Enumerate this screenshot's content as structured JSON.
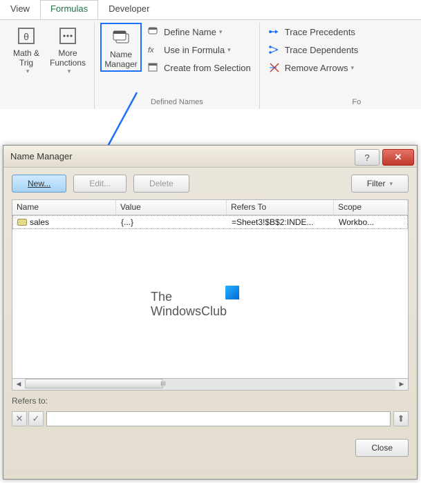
{
  "ribbon": {
    "tabs": {
      "view": "View",
      "formulas": "Formulas",
      "developer": "Developer"
    },
    "mathTrig": "Math & Trig",
    "moreFunc": "More Functions",
    "nameMgr": "Name Manager",
    "defineName": "Define Name",
    "useInFormula": "Use in Formula",
    "createFromSel": "Create from Selection",
    "definedNamesGroup": "Defined Names",
    "tracePrec": "Trace Precedents",
    "traceDep": "Trace Dependents",
    "removeArrows": "Remove Arrows",
    "formulaAuditGroup": "Fo"
  },
  "dialog": {
    "title": "Name Manager",
    "newBtn": "New...",
    "editBtn": "Edit...",
    "deleteBtn": "Delete",
    "filterBtn": "Filter",
    "cols": {
      "name": "Name",
      "value": "Value",
      "refers": "Refers To",
      "scope": "Scope"
    },
    "row": {
      "name": "sales",
      "value": "{...}",
      "refers": "=Sheet3!$B$2:INDE...",
      "scope": "Workbo..."
    },
    "refersLabel": "Refers to:",
    "close": "Close"
  },
  "watermark": {
    "line1": "The",
    "line2": "WindowsClub"
  }
}
